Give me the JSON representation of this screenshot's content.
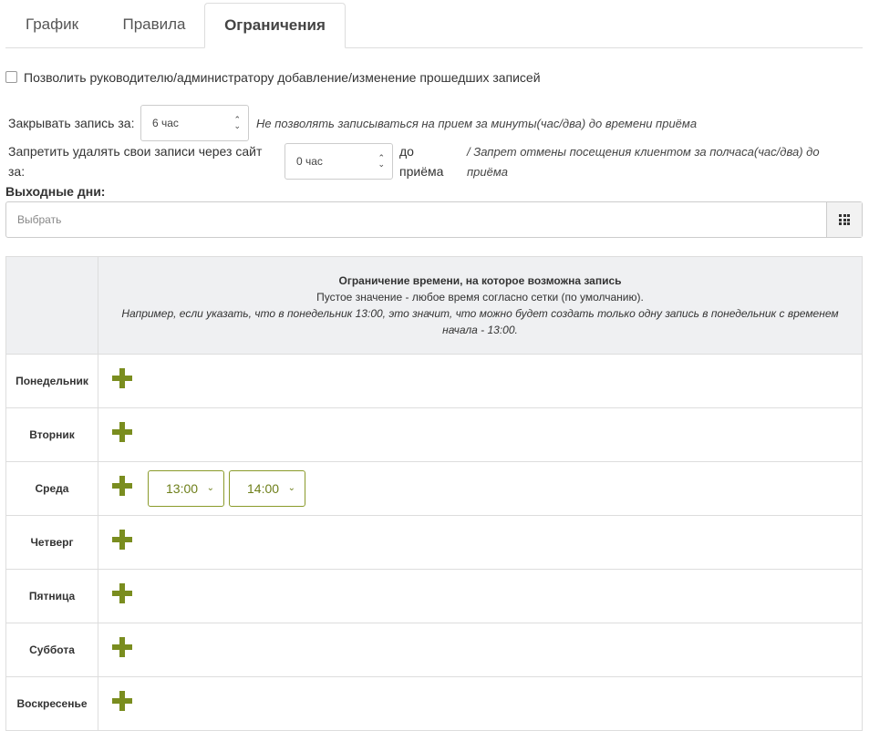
{
  "tabs": [
    {
      "label": "График"
    },
    {
      "label": "Правила"
    },
    {
      "label": "Ограничения"
    }
  ],
  "allow_past": {
    "label": "Позволить руководителю/администратору добавление/изменение прошедших записей",
    "checked": false
  },
  "close_booking": {
    "label": "Закрывать запись за:",
    "value": "6 час",
    "hint": "Не позволять записываться на прием за минуты(час/два) до времени приёма"
  },
  "forbid_delete": {
    "label_line1": "Запретить удалять свои записи через сайт",
    "label_line2": "за:",
    "value": "0 час",
    "suffix_line1": "до",
    "suffix_line2": "приёма",
    "hint_line1": "/ Запрет отмены посещения клиентом за полчаса(час/два) до",
    "hint_line2": "приёма"
  },
  "days_off": {
    "label": "Выходные дни:",
    "placeholder": "Выбрать"
  },
  "table": {
    "header_title": "Ограничение времени, на которое возможна запись",
    "header_sub": "Пустое значение - любое время согласно сетки (по умолчанию).",
    "header_note": "Например, если указать, что в понедельник 13:00, это значит, что можно будет создать только одну запись в понедельник с временем начала - 13:00.",
    "days": [
      {
        "name": "Понедельник",
        "times": []
      },
      {
        "name": "Вторник",
        "times": []
      },
      {
        "name": "Среда",
        "times": [
          "13:00",
          "14:00"
        ]
      },
      {
        "name": "Четверг",
        "times": []
      },
      {
        "name": "Пятница",
        "times": []
      },
      {
        "name": "Суббота",
        "times": []
      },
      {
        "name": "Воскресенье",
        "times": []
      }
    ]
  },
  "colors": {
    "accent": "#7a8d1f",
    "header_bg": "#eff0f2",
    "border": "#dddddd"
  }
}
